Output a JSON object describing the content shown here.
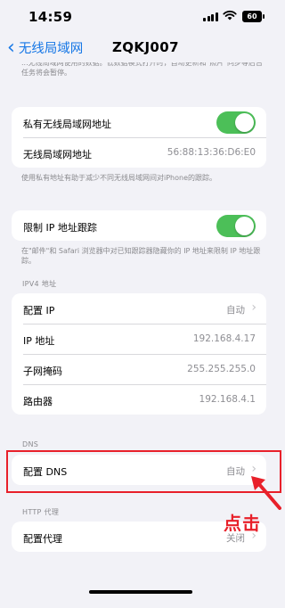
{
  "status_bar": {
    "time": "14:59",
    "battery": "60"
  },
  "nav": {
    "back_label": "无线局域网",
    "title": "ZQKJ007"
  },
  "header_note": "...无线局域网使用的数据。低数据模式打开时，自动更新和\"照片\"同步等后台任务将会暂停。",
  "private_address": {
    "toggle_label": "私有无线局域网地址",
    "toggle_on": true,
    "address_label": "无线局域网地址",
    "address_value": "56:88:13:36:D6:E0",
    "footer": "使用私有地址有助于减少不同无线局域网间对iPhone的跟踪。"
  },
  "limit_tracking": {
    "label": "限制 IP 地址跟踪",
    "toggle_on": true,
    "footer": "在\"邮件\"和 Safari 浏览器中对已知跟踪器隐藏你的 IP 地址来限制 IP 地址跟踪。"
  },
  "ipv4": {
    "header": "IPV4 地址",
    "rows": [
      {
        "label": "配置 IP",
        "value": "自动"
      },
      {
        "label": "IP 地址",
        "value": "192.168.4.17"
      },
      {
        "label": "子网掩码",
        "value": "255.255.255.0"
      },
      {
        "label": "路由器",
        "value": "192.168.4.1"
      }
    ]
  },
  "dns": {
    "header": "DNS",
    "label": "配置 DNS",
    "value": "自动"
  },
  "http_proxy": {
    "header": "HTTP 代理",
    "label": "配置代理",
    "value": "关闭"
  },
  "annotation": {
    "text": "点击",
    "color": "#e8202a"
  },
  "colors": {
    "accent": "#1677e6",
    "toggle_on": "#4cbf58",
    "background": "#f2f2f7"
  }
}
